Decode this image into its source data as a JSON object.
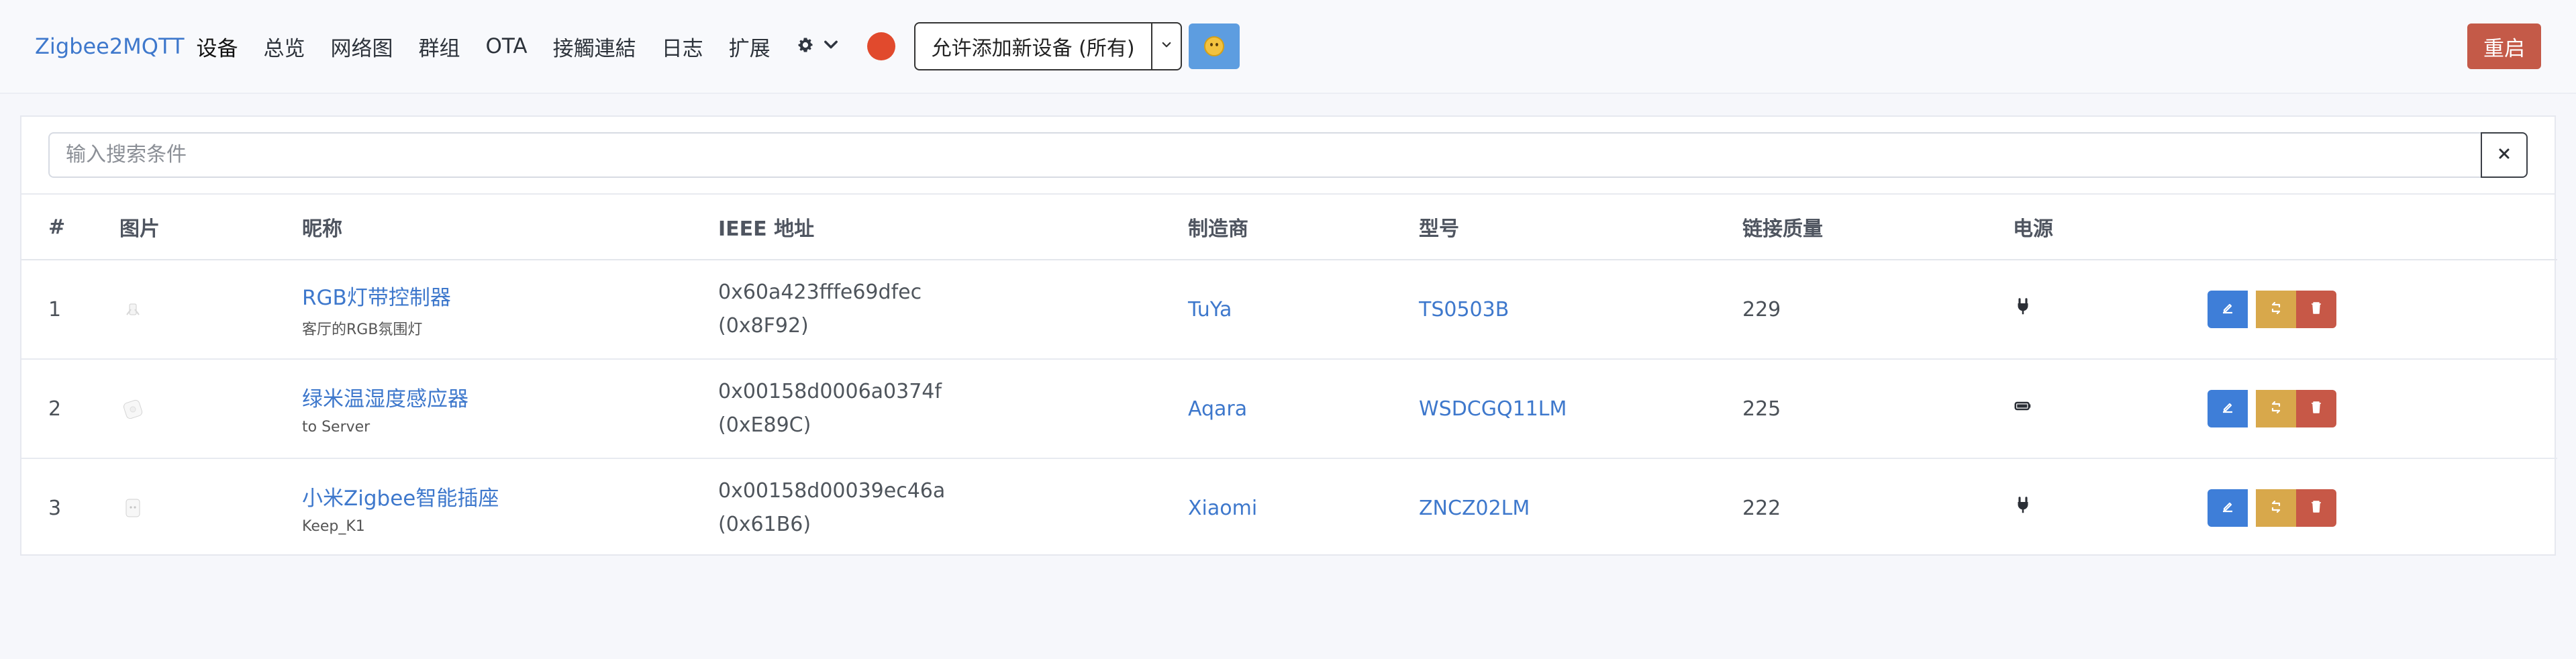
{
  "nav": {
    "brand": "Zigbee2MQTT",
    "items": [
      "设备",
      "总览",
      "网络图",
      "群组",
      "OTA",
      "接觸連結",
      "日志",
      "扩展"
    ],
    "permit_join_label": "允许添加新设备 (所有)",
    "restart_label": "重启"
  },
  "search": {
    "placeholder": "输入搜索条件"
  },
  "table": {
    "headers": [
      "#",
      "图片",
      "昵称",
      "IEEE 地址",
      "制造商",
      "型号",
      "链接质量",
      "电源",
      ""
    ],
    "rows": [
      {
        "index": "1",
        "nickname": "RGB灯带控制器",
        "description": "客厅的RGB氛围灯",
        "ieee": "0x60a423fffe69dfec",
        "network": "(0x8F92)",
        "manufacturer": "TuYa",
        "model": "TS0503B",
        "lqi": "229",
        "power": "plug"
      },
      {
        "index": "2",
        "nickname": "绿米温湿度感应器",
        "description": "to Server",
        "ieee": "0x00158d0006a0374f",
        "network": "(0xE89C)",
        "manufacturer": "Aqara",
        "model": "WSDCGQ11LM",
        "lqi": "225",
        "power": "battery"
      },
      {
        "index": "3",
        "nickname": "小米Zigbee智能插座",
        "description": "Keep_K1",
        "ieee": "0x00158d00039ec46a",
        "network": "(0x61B6)",
        "manufacturer": "Xiaomi",
        "model": "ZNCZ02LM",
        "lqi": "222",
        "power": "plug"
      }
    ]
  },
  "colors": {
    "brand": "#3e78cc",
    "status_dot": "#e14a2d",
    "restart": "#c45a48",
    "edit": "#3e7ed8",
    "rename": "#d8a84b",
    "delete": "#c75847"
  }
}
